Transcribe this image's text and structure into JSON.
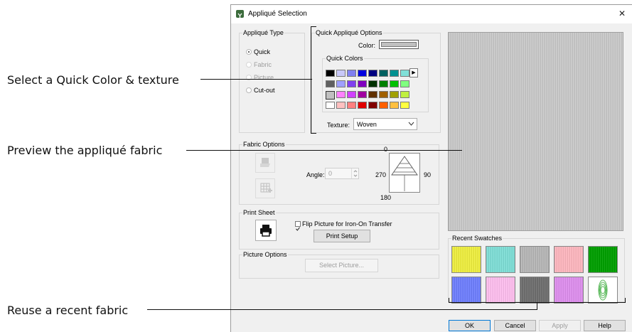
{
  "callouts": {
    "quick_color": "Select a Quick Color & texture",
    "preview": "Preview the appliqué fabric",
    "recent": "Reuse a recent fabric"
  },
  "dialog": {
    "title": "Appliqué Selection",
    "close_glyph": "✕"
  },
  "applique_type": {
    "label": "Appliqué Type",
    "options": [
      {
        "label": "Quick",
        "selected": true,
        "enabled": true
      },
      {
        "label": "Fabric",
        "selected": false,
        "enabled": false
      },
      {
        "label": "Picture",
        "selected": false,
        "enabled": false
      },
      {
        "label": "Cut-out",
        "selected": false,
        "enabled": true
      }
    ]
  },
  "quick_options": {
    "label": "Quick Appliqué  Options",
    "color_label": "Color:",
    "color_value": "#c0c0c0",
    "quick_colors_label": "Quick Colors",
    "more_glyph": "▶",
    "palette": [
      [
        "#000000",
        "#c8c8f8",
        "#8080f0",
        "#0000e0",
        "#000080",
        "#006060",
        "#009090",
        "#80e0d8"
      ],
      [
        "#606060",
        "#a0a0ff",
        "#8040f0",
        "#8000c0",
        "#003000",
        "#008000",
        "#00c000",
        "#80ff80"
      ],
      [
        "#c0c0c0",
        "#ff80ff",
        "#d040ff",
        "#a000a0",
        "#603000",
        "#a06000",
        "#a0a000",
        "#c0f040"
      ],
      [
        "#ffffff",
        "#ffc0c0",
        "#ff8080",
        "#e00000",
        "#800000",
        "#ff6000",
        "#ffc040",
        "#ffff40"
      ]
    ],
    "texture_label": "Texture:",
    "texture_value": "Woven"
  },
  "fabric_options": {
    "label": "Fabric Options",
    "angle_label": "Angle:",
    "angle_value": "0",
    "dial": {
      "top": "0",
      "left": "270",
      "right": "90",
      "bottom": "180"
    }
  },
  "print_sheet": {
    "label": "Print Sheet",
    "flip_label": "Flip Picture for Iron-On Transfer",
    "flip_checked": true,
    "print_setup_label": "Print Setup"
  },
  "picture_options": {
    "label": "Picture Options",
    "select_picture_label": "Select Picture..."
  },
  "recent_swatches": {
    "label": "Recent Swatches",
    "items": [
      {
        "color": "#f0f040",
        "pattern": "woven"
      },
      {
        "color": "#80e0d8",
        "pattern": "woven"
      },
      {
        "color": "#b8b8b8",
        "pattern": "woven"
      },
      {
        "color": "#ffb8c0",
        "pattern": "woven"
      },
      {
        "color": "#00a000",
        "pattern": "woven"
      },
      {
        "color": "#7080ff",
        "pattern": "woven"
      },
      {
        "color": "#ffc0f0",
        "pattern": "woven"
      },
      {
        "color": "#707070",
        "pattern": "woven"
      },
      {
        "color": "#e090f0",
        "pattern": "woven"
      },
      {
        "color": "#ffffff",
        "pattern": "circles"
      }
    ]
  },
  "buttons": {
    "ok": "OK",
    "cancel": "Cancel",
    "apply": "Apply",
    "help": "Help"
  }
}
